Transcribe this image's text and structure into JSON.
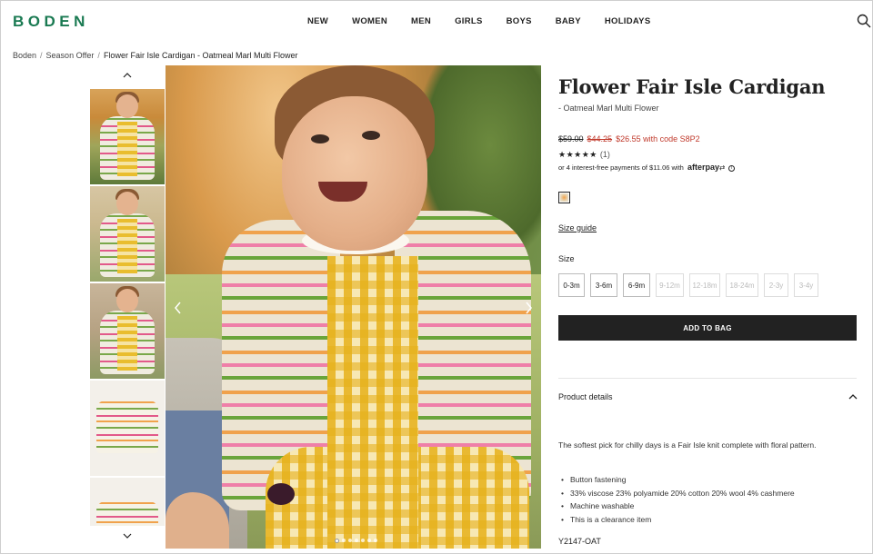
{
  "brand": {
    "logo": "BODEN",
    "accent": "#1a7a52"
  },
  "nav": {
    "items": [
      "NEW",
      "WOMEN",
      "MEN",
      "GIRLS",
      "BOYS",
      "BABY",
      "HOLIDAYS"
    ]
  },
  "breadcrumb": {
    "items": [
      "Boden",
      "Season Offer",
      "Flower Fair Isle Cardigan - Oatmeal Marl Multi Flower"
    ],
    "separator": "/"
  },
  "gallery": {
    "thumbnails": [
      "thumb-1",
      "thumb-2",
      "thumb-3",
      "thumb-4",
      "thumb-5"
    ],
    "slide_count": 7,
    "active_slide": 1
  },
  "product": {
    "title": "Flower Fair Isle Cardigan",
    "subtitle": "- Oatmeal Marl Multi Flower",
    "price_original": "$59.00",
    "price_was": "$44.25",
    "price_now": "$26.55 with code S8P2",
    "rating_stars": "★★★★★",
    "rating_count": "(1)",
    "afterpay_text": "or 4 interest-free payments of $11.06 with",
    "afterpay_brand": "afterpay",
    "afterpay_info": "i",
    "size_guide": "Size guide",
    "size_label": "Size",
    "sizes": [
      {
        "label": "0-3m",
        "available": true
      },
      {
        "label": "3-6m",
        "available": true
      },
      {
        "label": "6-9m",
        "available": true
      },
      {
        "label": "9-12m",
        "available": false
      },
      {
        "label": "12-18m",
        "available": false
      },
      {
        "label": "18-24m",
        "available": false
      },
      {
        "label": "2-3y",
        "available": false
      },
      {
        "label": "3-4y",
        "available": false
      }
    ],
    "add_to_bag": "ADD TO BAG",
    "details_heading": "Product details",
    "description": "The softest pick for chilly days is a Fair Isle knit complete with floral pattern.",
    "bullets": [
      "Button fastening",
      "33% viscose 23% polyamide 20% cotton 20% wool 4% cashmere",
      "Machine washable",
      "This is a clearance item"
    ],
    "code": "Y2147-OAT"
  },
  "colors": {
    "sale_red": "#c0392b",
    "button_dark": "#222222"
  }
}
